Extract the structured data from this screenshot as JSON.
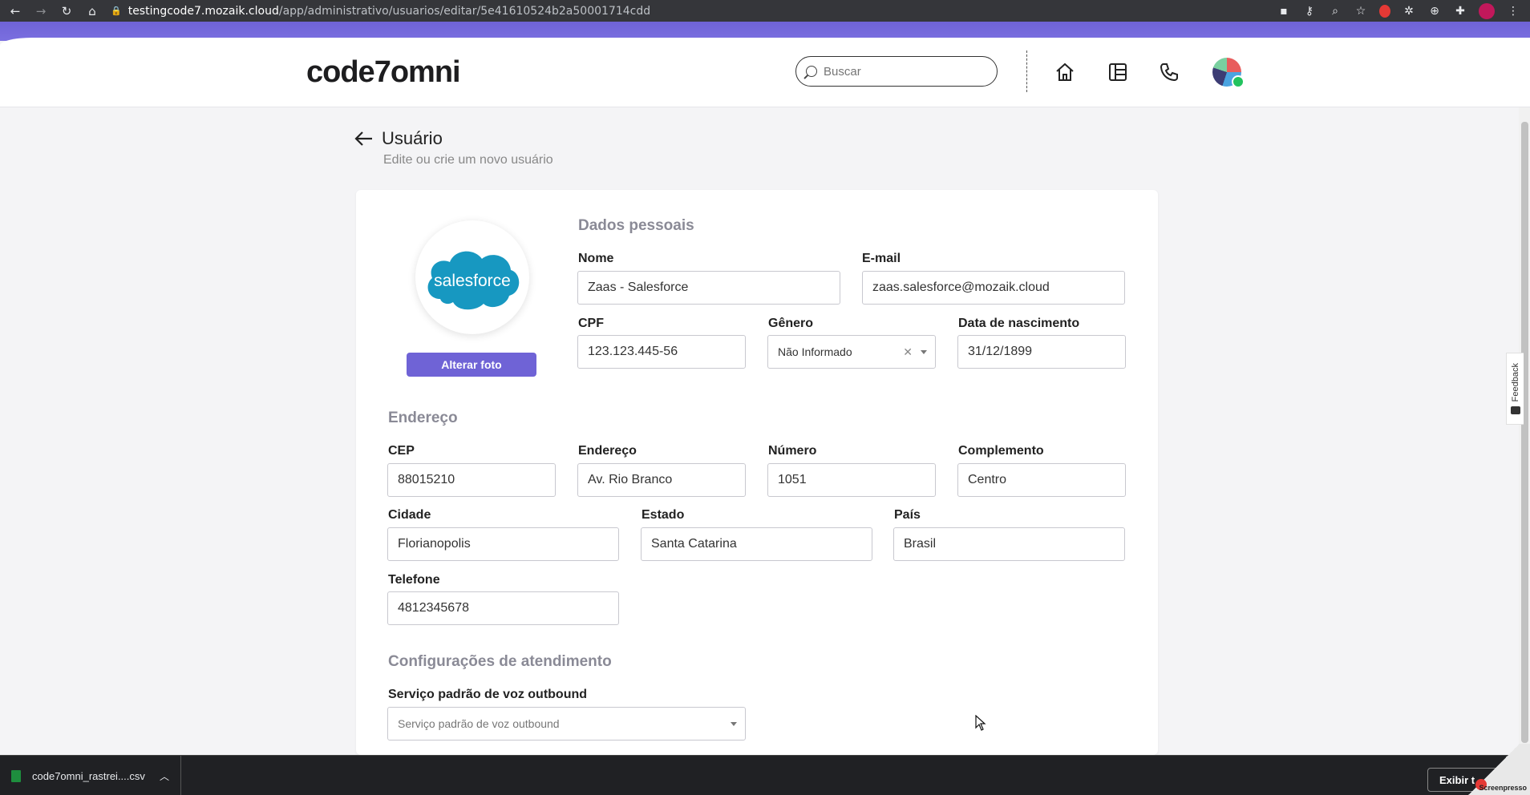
{
  "browser": {
    "url_host": "testingcode7.mozaik.cloud",
    "url_path": "/app/administrativo/usuarios/editar/5e41610524b2a50001714cdd"
  },
  "header": {
    "logo": "code7omni",
    "search_placeholder": "Buscar"
  },
  "page": {
    "title": "Usuário",
    "subtitle": "Edite ou crie um novo usuário"
  },
  "profile": {
    "photo_logo_text": "salesforce",
    "change_photo_label": "Alterar foto"
  },
  "personal": {
    "section_title": "Dados pessoais",
    "name_label": "Nome",
    "name_value": "Zaas - Salesforce",
    "email_label": "E-mail",
    "email_value": "zaas.salesforce@mozaik.cloud",
    "cpf_label": "CPF",
    "cpf_value": "123.123.445-56",
    "gender_label": "Gênero",
    "gender_value": "Não Informado",
    "birth_label": "Data de nascimento",
    "birth_value": "31/12/1899"
  },
  "address": {
    "section_title": "Endereço",
    "cep_label": "CEP",
    "cep_value": "88015210",
    "street_label": "Endereço",
    "street_value": "Av. Rio Branco",
    "number_label": "Número",
    "number_value": "1051",
    "complement_label": "Complemento",
    "complement_value": "Centro",
    "city_label": "Cidade",
    "city_value": "Florianopolis",
    "state_label": "Estado",
    "state_value": "Santa Catarina",
    "country_label": "País",
    "country_value": "Brasil",
    "phone_label": "Telefone",
    "phone_value": "4812345678"
  },
  "service": {
    "section_title": "Configurações de atendimento",
    "voice_label": "Serviço padrão de voz outbound",
    "voice_placeholder": "Serviço padrão de voz outbound"
  },
  "side": {
    "feedback_label": "Feedback"
  },
  "downloads": {
    "file_name": "code7omni_rastrei....csv",
    "show_all": "Exibir t",
    "screenpresso": "Screenpresso"
  },
  "colors": {
    "accent": "#6f63d6",
    "online": "#22c35e",
    "salesforce": "#1798c1"
  }
}
